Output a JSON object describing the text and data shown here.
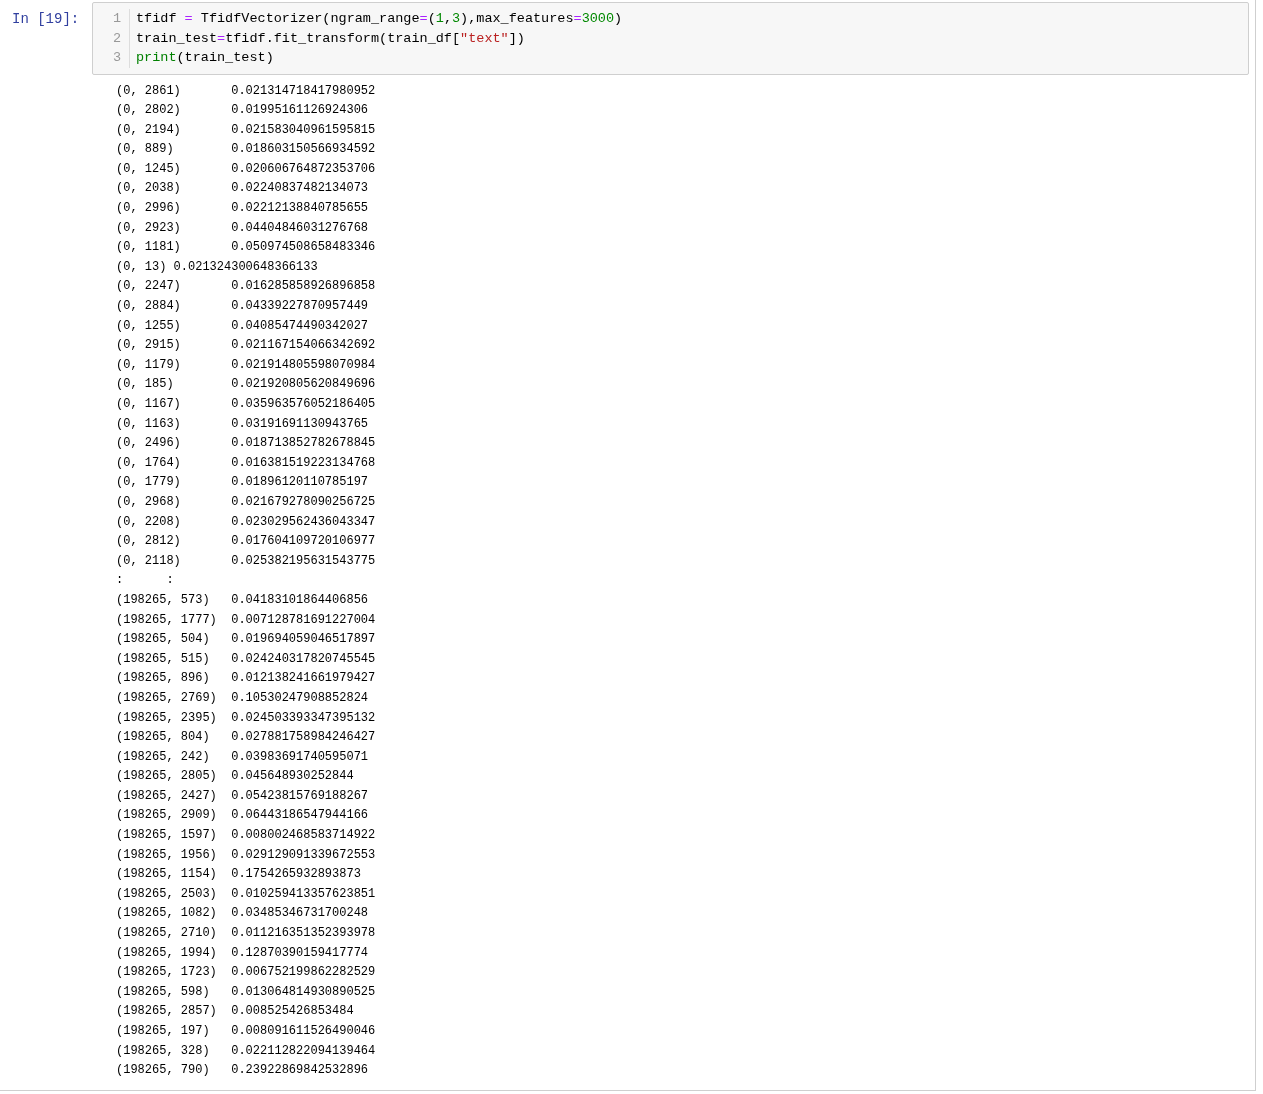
{
  "cell": {
    "prompt": "In [19]:",
    "code_lines": [
      {
        "number": "1",
        "tokens": [
          {
            "kind": "plain",
            "text": "tfidf "
          },
          {
            "kind": "op",
            "text": "="
          },
          {
            "kind": "plain",
            "text": " TfidfVectorizer(ngram_range"
          },
          {
            "kind": "op",
            "text": "="
          },
          {
            "kind": "plain",
            "text": "("
          },
          {
            "kind": "num",
            "text": "1"
          },
          {
            "kind": "plain",
            "text": ","
          },
          {
            "kind": "num",
            "text": "3"
          },
          {
            "kind": "plain",
            "text": "),max_features"
          },
          {
            "kind": "op",
            "text": "="
          },
          {
            "kind": "num",
            "text": "3000"
          },
          {
            "kind": "plain",
            "text": ")"
          }
        ]
      },
      {
        "number": "2",
        "tokens": [
          {
            "kind": "plain",
            "text": "train_test"
          },
          {
            "kind": "op",
            "text": "="
          },
          {
            "kind": "plain",
            "text": "tfidf.fit_transform(train_df["
          },
          {
            "kind": "str",
            "text": "\"text\""
          },
          {
            "kind": "plain",
            "text": "])"
          }
        ]
      },
      {
        "number": "3",
        "tokens": [
          {
            "kind": "builtin",
            "text": "print"
          },
          {
            "kind": "plain",
            "text": "(train_test)"
          }
        ]
      }
    ],
    "output_lines": [
      "(0, 2861)\t0.021314718417980952",
      "(0, 2802)\t0.01995161126924306",
      "(0, 2194)\t0.021583040961595815",
      "(0, 889)\t0.018603150566934592",
      "(0, 1245)\t0.020606764872353706",
      "(0, 2038)\t0.02240837482134073",
      "(0, 2996)\t0.02212138840785655",
      "(0, 2923)\t0.04404846031276768",
      "(0, 1181)\t0.050974508658483346",
      "(0, 13)\t0.021324300648366133",
      "(0, 2247)\t0.016285858926896858",
      "(0, 2884)\t0.04339227870957449",
      "(0, 1255)\t0.04085474490342027",
      "(0, 2915)\t0.021167154066342692",
      "(0, 1179)\t0.021914805598070984",
      "(0, 185)\t0.021920805620849696",
      "(0, 1167)\t0.035963576052186405",
      "(0, 1163)\t0.03191691130943765",
      "(0, 2496)\t0.018713852782678845",
      "(0, 1764)\t0.016381519223134768",
      "(0, 1779)\t0.01896120110785197",
      "(0, 2968)\t0.021679278090256725",
      "(0, 2208)\t0.023029562436043347",
      "(0, 2812)\t0.017604109720106977",
      "(0, 2118)\t0.025382195631543775",
      ":      :",
      "(198265, 573)\t0.04183101864406856",
      "(198265, 1777)\t0.007128781691227004",
      "(198265, 504)\t0.019694059046517897",
      "(198265, 515)\t0.02424031782074554­5",
      "(198265, 896)\t0.012138241661979427",
      "(198265, 2769)\t0.10530247908852824",
      "(198265, 2395)\t0.024503393347395132",
      "(198265, 804)\t0.027881758984246427",
      "(198265, 242)\t0.03983691740595071",
      "(198265, 2805)\t0.045648930252844",
      "(198265, 2427)\t0.05423815769188267",
      "(198265, 2909)\t0.06443186547944166",
      "(198265, 1597)\t0.008002468583714922",
      "(198265, 1956)\t0.029129091339672553",
      "(198265, 1154)\t0.1754265932893873",
      "(198265, 2503)\t0.010259413357623851",
      "(198265, 1082)\t0.03485346731700248",
      "(198265, 2710)\t0.011216351352393978",
      "(198265, 1994)\t0.12870390159417774",
      "(198265, 1723)\t0.006752199862282529",
      "(198265, 598)\t0.013064814930890525",
      "(198265, 2857)\t0.008525426853484",
      "(198265, 197)\t0.008091611526490046",
      "(198265, 328)\t0.022112822094139464",
      "(198265, 790)\t0.23922869842532896"
    ]
  }
}
